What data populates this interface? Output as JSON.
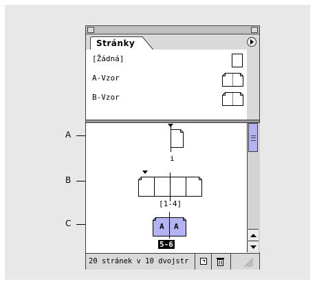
{
  "panel": {
    "tab_label": "Stránky",
    "menu_icon": "flyout-menu-arrow-icon"
  },
  "masters": [
    {
      "label": "[Žádná]",
      "icon": "single-page-icon"
    },
    {
      "label": "A-Vzor",
      "icon": "master-spread-icon"
    },
    {
      "label": "B-Vzor",
      "icon": "master-spread-icon"
    }
  ],
  "pages": {
    "spread1_label": "i",
    "spread2_label": "[1-4]",
    "spread3_label": "5-6",
    "spread3_master_letters": [
      "A",
      "A"
    ]
  },
  "status": {
    "text": "20 stránek v 10 dvojstr",
    "new_page_icon": "new-page-icon",
    "delete_icon": "trash-icon",
    "resize_icon": "resize-grip-icon"
  },
  "callouts": [
    "A",
    "B",
    "C"
  ],
  "colors": {
    "selection": "#b3b3f4",
    "panel_gray": "#d9d9d9",
    "frame": "#3a3a3a"
  }
}
